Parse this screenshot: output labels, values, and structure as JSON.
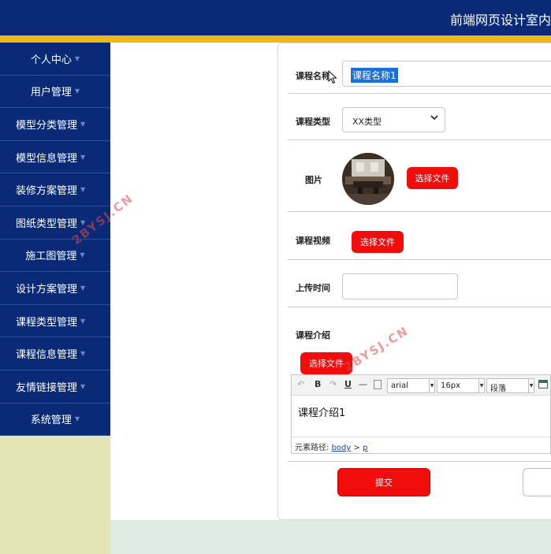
{
  "header": {
    "title": "前端网页设计室内"
  },
  "sidebar": {
    "items": [
      {
        "label": "个人中心",
        "align": "center"
      },
      {
        "label": "用户管理",
        "align": "center"
      },
      {
        "label": "模型分类管理",
        "align": "left"
      },
      {
        "label": "模型信息管理",
        "align": "left"
      },
      {
        "label": "装修方案管理",
        "align": "left"
      },
      {
        "label": "图纸类型管理",
        "align": "left"
      },
      {
        "label": "施工图管理",
        "align": "center"
      },
      {
        "label": "设计方案管理",
        "align": "left"
      },
      {
        "label": "课程类型管理",
        "align": "left"
      },
      {
        "label": "课程信息管理",
        "align": "left"
      },
      {
        "label": "友情链接管理",
        "align": "left"
      },
      {
        "label": "系统管理",
        "align": "center"
      }
    ]
  },
  "form": {
    "course_name": {
      "label": "课程名称",
      "value": "课程名称1"
    },
    "course_type": {
      "label": "课程类型",
      "value": "XX类型"
    },
    "image": {
      "label": "图片",
      "button": "选择文件"
    },
    "video": {
      "label": "课程视频",
      "button": "选择文件"
    },
    "upload_time": {
      "label": "上传时间",
      "value": ""
    },
    "intro": {
      "label": "课程介绍",
      "button": "选择文件"
    }
  },
  "editor": {
    "toolbar": {
      "bold": "B",
      "underline": "U",
      "hr": "—",
      "font_family": "arial",
      "font_size": "16px",
      "paragraph": "段落"
    },
    "content": "课程介绍1",
    "path_label": "元素路径:",
    "path_body": "body",
    "path_sep": ">",
    "path_p": "p"
  },
  "actions": {
    "submit": "提交"
  },
  "watermark": {
    "text": "2BYSJ.CN"
  },
  "colors": {
    "header": "#0a2a78",
    "stripe": "#f0b814",
    "sidebar_bg": "#e5e4b4",
    "button_red": "#f20d0d"
  }
}
